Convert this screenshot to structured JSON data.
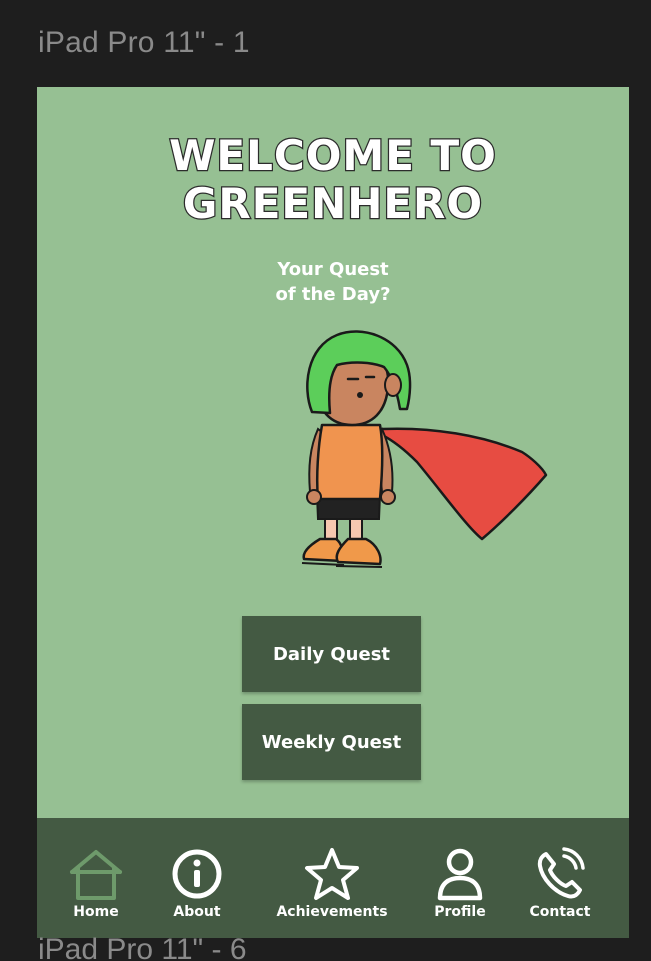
{
  "editor": {
    "frame_label_top": "iPad Pro 11\" - 1",
    "frame_label_bottom": "iPad Pro 11\" - 6"
  },
  "app": {
    "title_line1": "WELCOME TO",
    "title_line2": "GREENHERO",
    "subtitle_line1": "Your Quest",
    "subtitle_line2": "of the Day?",
    "buttons": {
      "daily": "Daily Quest",
      "weekly": "Weekly Quest"
    },
    "nav": [
      {
        "label": "Home",
        "icon": "home-icon"
      },
      {
        "label": "About",
        "icon": "info-icon"
      },
      {
        "label": "Achievements",
        "icon": "star-icon"
      },
      {
        "label": "Profile",
        "icon": "user-icon"
      },
      {
        "label": "Contact",
        "icon": "phone-icon"
      }
    ],
    "colors": {
      "background": "#96c093",
      "dark_green": "#445a43",
      "home_icon_active": "#6e9a6b",
      "editor_bg": "#1e1e1e"
    }
  }
}
